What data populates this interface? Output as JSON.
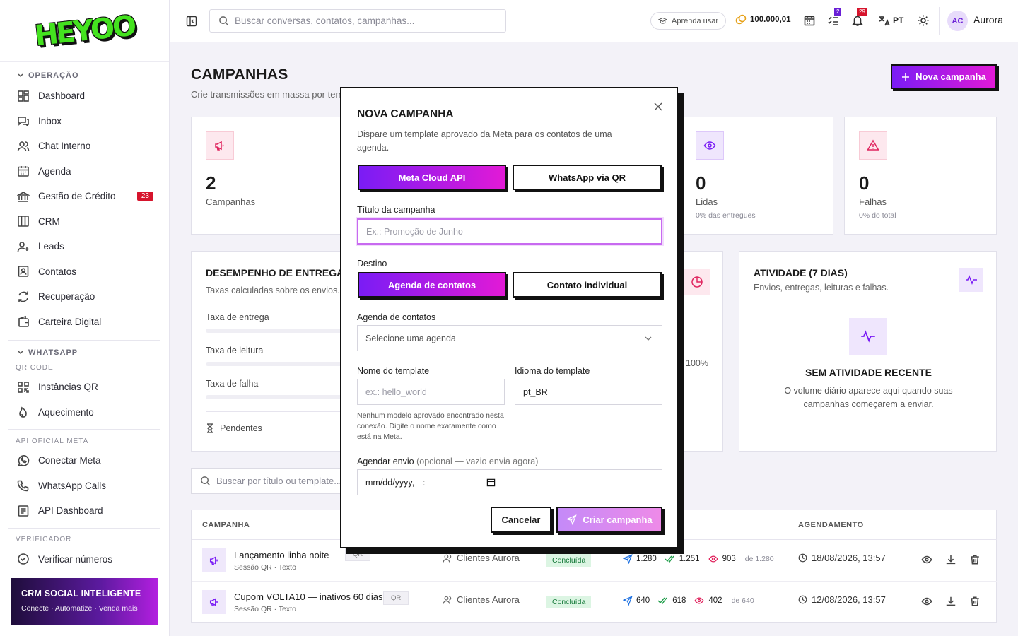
{
  "brand": {
    "logo_text": "HEYOO"
  },
  "sidebar": {
    "sections": [
      {
        "title": "OPERAÇÃO"
      },
      {
        "title": "WHATSAPP",
        "sub": "QR CODE"
      }
    ],
    "operacao": [
      {
        "label": "Dashboard",
        "icon": "dashboard-icon"
      },
      {
        "label": "Inbox",
        "icon": "inbox-icon"
      },
      {
        "label": "Chat Interno",
        "icon": "users-icon"
      },
      {
        "label": "Agenda",
        "icon": "calendar-icon"
      },
      {
        "label": "Gestão de Crédito",
        "icon": "bank-icon",
        "badge": "23"
      },
      {
        "label": "CRM",
        "icon": "columns-icon"
      },
      {
        "label": "Leads",
        "icon": "user-plus-icon"
      },
      {
        "label": "Contatos",
        "icon": "contact-icon"
      },
      {
        "label": "Recuperação",
        "icon": "refresh-icon"
      },
      {
        "label": "Carteira Digital",
        "icon": "wallet-icon"
      }
    ],
    "qr": [
      {
        "label": "Instâncias QR",
        "icon": "qr-icon"
      },
      {
        "label": "Aquecimento",
        "icon": "flame-icon"
      }
    ],
    "meta_title": "API OFICIAL META",
    "meta": [
      {
        "label": "Conectar Meta",
        "icon": "whatsapp-icon"
      },
      {
        "label": "WhatsApp Calls",
        "icon": "phone-icon"
      },
      {
        "label": "API Dashboard",
        "icon": "api-icon"
      }
    ],
    "verif_title": "VERIFICADOR",
    "verif": [
      {
        "label": "Verificar números",
        "icon": "check-circle-icon"
      }
    ],
    "promo": {
      "title": "CRM SOCIAL INTELIGENTE",
      "tagline": "Conecte · Automatize · Venda mais"
    }
  },
  "topbar": {
    "search_placeholder": "Buscar conversas, contatos, campanhas...",
    "learn": "Aprenda usar",
    "credits": "100.000,01",
    "tasks_count": "2",
    "notif_count": "29",
    "lang": "PT",
    "avatar": "AC",
    "user": "Aurora"
  },
  "page": {
    "title": "CAMPANHAS",
    "subtitle": "Crie transmissões em massa por temp",
    "new_button": "Nova campanha",
    "stats": [
      {
        "num": "2",
        "label": "Campanhas",
        "pct": "",
        "color": "#e0245e"
      },
      {
        "num": "0",
        "label": "Lidas",
        "pct": "0% das entregues",
        "color": "#7a1cf5"
      },
      {
        "num": "0",
        "label": "Falhas",
        "pct": "0% do total",
        "color": "#e0245e"
      }
    ],
    "perf": {
      "title": "DESEMPENHO DE ENTREGA",
      "sub": "Taxas calculadas sobre os envios.",
      "rates": [
        "Taxa de entrega",
        "Taxa de leitura",
        "Taxa de falha"
      ],
      "pending": "Pendentes",
      "pct_label": "100%"
    },
    "activity": {
      "title": "ATIVIDADE (7 DIAS)",
      "sub": "Envios, entregas, leituras e falhas.",
      "empty_title": "SEM ATIVIDADE RECENTE",
      "empty_text": "O volume diário aparece aqui quando suas campanhas começarem a enviar."
    },
    "table_search": "Buscar por título ou template...",
    "table": {
      "headers": [
        "CAMPANHA",
        "AGENDAMENTO"
      ],
      "rows": [
        {
          "name": "Lançamento linha noite",
          "tag": "QR",
          "meta": "Sessão QR · Texto",
          "audience": "Clientes Aurora",
          "status": "Concluída",
          "sent": "1.280",
          "delivered": "1.251",
          "read": "903",
          "of": "de 1.280",
          "date": "18/08/2026, 13:57"
        },
        {
          "name": "Cupom VOLTA10 — inativos 60 dias",
          "tag": "QR",
          "meta": "Sessão QR · Texto",
          "audience": "Clientes Aurora",
          "status": "Concluída",
          "sent": "640",
          "delivered": "618",
          "read": "402",
          "of": "de 640",
          "date": "12/08/2026, 13:57"
        }
      ]
    }
  },
  "modal": {
    "title": "NOVA CAMPANHA",
    "desc": "Dispare um template aprovado da Meta para os contatos de uma agenda.",
    "channel_a": "Meta Cloud API",
    "channel_b": "WhatsApp via QR",
    "title_label": "Título da campanha",
    "title_placeholder": "Ex.: Promoção de Junho",
    "dest_label": "Destino",
    "dest_a": "Agenda de contatos",
    "dest_b": "Contato individual",
    "agenda_label": "Agenda de contatos",
    "agenda_placeholder": "Selecione uma agenda",
    "tpl_label": "Nome do template",
    "tpl_placeholder": "ex.: hello_world",
    "lang_label": "Idioma do template",
    "lang_value": "pt_BR",
    "hint": "Nenhum modelo aprovado encontrado nesta conexão. Digite o nome exatamente como está na Meta.",
    "sched_label": "Agendar envio",
    "sched_opt": "(opcional — vazio envia agora)",
    "sched_value": "mm/dd/yyyy, --:-- --",
    "cancel": "Cancelar",
    "create": "Criar campanha"
  }
}
